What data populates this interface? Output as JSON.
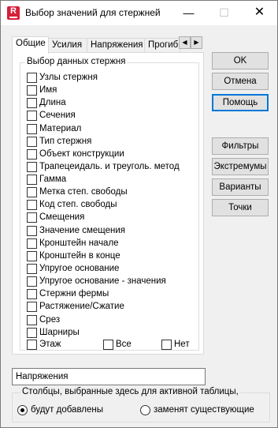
{
  "window": {
    "title": "Выбор значений для стержней",
    "icon_letter": "R",
    "minimize_glyph": "—",
    "maximize_glyph": "☐",
    "close_glyph": "✕"
  },
  "tabs": [
    {
      "label": "Общие",
      "active": true
    },
    {
      "label": "Усилия",
      "active": false
    },
    {
      "label": "Напряжения",
      "active": false
    },
    {
      "label": "Прогиб",
      "active": false
    }
  ],
  "tab_scroll": {
    "left": "◀",
    "right": "▶"
  },
  "group": {
    "title": "Выбор данных стержня",
    "items": [
      {
        "label": "Узлы стержня",
        "checked": false
      },
      {
        "label": "Имя",
        "checked": false
      },
      {
        "label": "Длина",
        "checked": false
      },
      {
        "label": "Сечения",
        "checked": false
      },
      {
        "label": "Материал",
        "checked": false
      },
      {
        "label": "Тип стержня",
        "checked": false
      },
      {
        "label": "Объект конструкции",
        "checked": false
      },
      {
        "label": "Трапецеидаль. и треуголь. метод",
        "checked": false
      },
      {
        "label": "Гамма",
        "checked": false
      },
      {
        "label": "Метка степ. свободы",
        "checked": false
      },
      {
        "label": "Код степ. свободы",
        "checked": false
      },
      {
        "label": "Смещения",
        "checked": false
      },
      {
        "label": "Значение смещения",
        "checked": false
      },
      {
        "label": "Кронштейн начале",
        "checked": false
      },
      {
        "label": "Кронштейн в конце",
        "checked": false
      },
      {
        "label": "Упругое основание",
        "checked": false
      },
      {
        "label": "Упругое основание - значения",
        "checked": false
      },
      {
        "label": "Стержни фермы",
        "checked": false
      },
      {
        "label": "Растяжение/Сжатие",
        "checked": false
      },
      {
        "label": "Срез",
        "checked": false
      },
      {
        "label": "Шарниры",
        "checked": false
      },
      {
        "label": "Этаж",
        "checked": false
      }
    ],
    "all_label": "Все",
    "none_label": "Нет"
  },
  "buttons": {
    "ok": "OK",
    "cancel": "Отмена",
    "help": "Помощь",
    "filters": "Фильтры",
    "extremes": "Экстремумы",
    "variants": "Варианты",
    "points": "Точки"
  },
  "name_field": {
    "value": "Напряжения"
  },
  "columns_group": {
    "title": "Столбцы, выбранные здесь для активной таблицы,",
    "options": [
      {
        "label": "будут добавлены",
        "selected": true
      },
      {
        "label": "заменят существующие",
        "selected": false
      }
    ]
  },
  "colors": {
    "focus_border": "#0078d7",
    "app_icon": "#d81e37"
  }
}
